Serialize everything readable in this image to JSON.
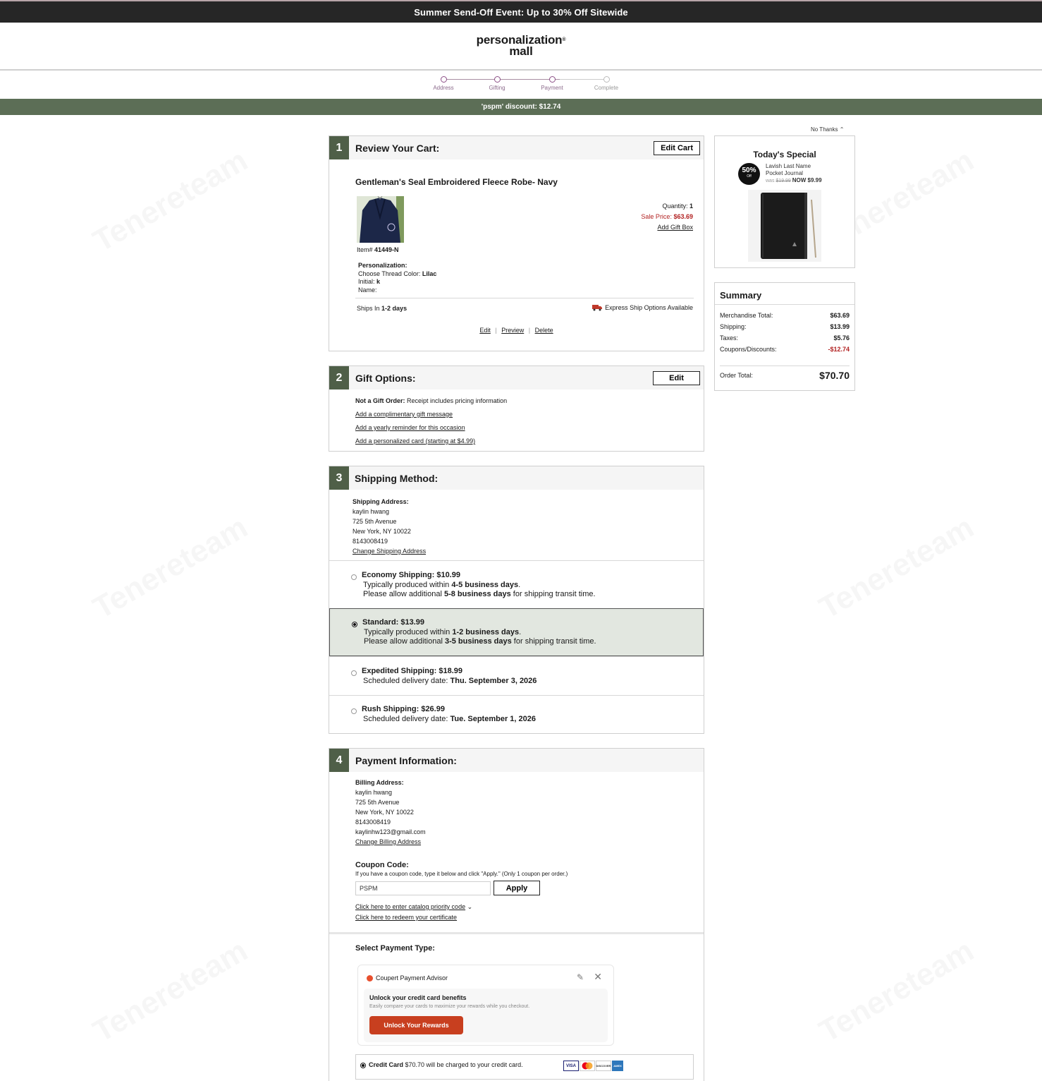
{
  "promo": {
    "text": "Summer Send-Off Event: Up to 30% Off Sitewide"
  },
  "brand": {
    "line1": "personalization",
    "line2": "mall",
    "accent": "#5c6e56",
    "step_color": "#8c4f87"
  },
  "steps": [
    {
      "label": "Address",
      "active": true
    },
    {
      "label": "Gifting",
      "active": true
    },
    {
      "label": "Payment",
      "active": true
    },
    {
      "label": "Complete",
      "active": false
    }
  ],
  "discount_bar": {
    "text": "'pspm' discount: $12.74"
  },
  "cart": {
    "number": "1",
    "title": "Review Your Cart:",
    "edit_cart": "Edit Cart",
    "product_name": "Gentleman's Seal Embroidered Fleece Robe- Navy",
    "quantity_label": "Quantity:",
    "quantity": "1",
    "sale_price_label": "Sale Price:",
    "sale_price": "$63.69",
    "add_gift_box": "Add Gift Box",
    "item_label": "Item#",
    "item_number": "41449-N",
    "personalization_heading": "Personalization:",
    "thread_label": "Choose Thread Color:",
    "thread_value": "Lilac",
    "initial_label": "Initial:",
    "initial_value": "k",
    "name_label": "Name:",
    "ships_label": "Ships In",
    "ships_value": "1-2 days",
    "express_text": "Express Ship Options Available",
    "actions": {
      "edit": "Edit",
      "preview": "Preview",
      "delete": "Delete"
    }
  },
  "gift": {
    "number": "2",
    "title": "Gift Options:",
    "edit": "Edit",
    "not_gift_label": "Not a Gift Order:",
    "not_gift_text": "Receipt includes pricing information",
    "links": [
      "Add a complimentary gift message",
      "Add a yearly reminder for this occasion",
      "Add a personalized card (starting at $4.99)"
    ]
  },
  "shipping": {
    "number": "3",
    "title": "Shipping Method:",
    "address_heading": "Shipping Address:",
    "address_lines": [
      "kaylin hwang",
      "725 5th Avenue",
      "New York, NY 10022",
      "8143008419"
    ],
    "change_link": "Change Shipping Address",
    "options": [
      {
        "title": "Economy Shipping: $10.99",
        "l1a": "Typically produced within ",
        "l1b": "4-5 business days",
        "l1c": ".",
        "l2a": "Please allow additional ",
        "l2b": "5-8 business days",
        "l2c": " for shipping transit time.",
        "selected": false
      },
      {
        "title": "Standard: $13.99",
        "l1a": "Typically produced within ",
        "l1b": "1-2 business days",
        "l1c": ".",
        "l2a": "Please allow additional ",
        "l2b": "3-5 business days",
        "l2c": " for shipping transit time.",
        "selected": true
      },
      {
        "title": "Expedited Shipping: $18.99",
        "l1a": "Scheduled delivery date: ",
        "l1b": "Thu. September 3, 2026",
        "selected": false
      },
      {
        "title": "Rush Shipping: $26.99",
        "l1a": "Scheduled delivery date: ",
        "l1b": "Tue. September 1, 2026",
        "selected": false
      }
    ]
  },
  "payment": {
    "number": "4",
    "title": "Payment Information:",
    "billing_heading": "Billing Address:",
    "billing_lines": [
      "kaylin hwang",
      "725 5th Avenue",
      "New York, NY 10022",
      "8143008419",
      "kaylinhw123@gmail.com"
    ],
    "change_link": "Change Billing Address",
    "coupon_heading": "Coupon Code:",
    "coupon_help": "If you have a coupon code, type it below and click \"Apply.\" (Only 1 coupon per order.)",
    "coupon_value": "PSPM",
    "apply": "Apply",
    "catalog_link": "Click here to enter catalog priority code",
    "certificate_link": "Click here to redeem your certificate",
    "select_type": "Select Payment Type:",
    "advisor": {
      "title": "Coupert Payment Advisor",
      "heading": "Unlock your credit card benefits",
      "sub": "Easily compare your cards to maximize your rewards while you checkout.",
      "button": "Unlock Your Rewards"
    },
    "credit_label": "Credit Card",
    "credit_text": "$70.70 will be charged to your credit card.",
    "cards": [
      "VISA",
      "MC",
      "DISCOVER",
      "AMEX"
    ]
  },
  "special": {
    "no_thanks": "No Thanks",
    "title": "Today's Special",
    "badge_pct": "50%",
    "badge_off": "Off",
    "product_line1": "Lavish Last Name",
    "product_line2": "Pocket Journal",
    "was_label": "was",
    "was_price": "$19.99",
    "now_text": "NOW $9.99"
  },
  "summary": {
    "title": "Summary",
    "rows": [
      {
        "label": "Merchandise Total:",
        "value": "$63.69"
      },
      {
        "label": "Shipping:",
        "value": "$13.99"
      },
      {
        "label": "Taxes:",
        "value": "$5.76"
      },
      {
        "label": "Coupons/Discounts:",
        "value": "-$12.74"
      }
    ],
    "total_label": "Order Total:",
    "total_value": "$70.70",
    "discount_color": "#b22222"
  }
}
